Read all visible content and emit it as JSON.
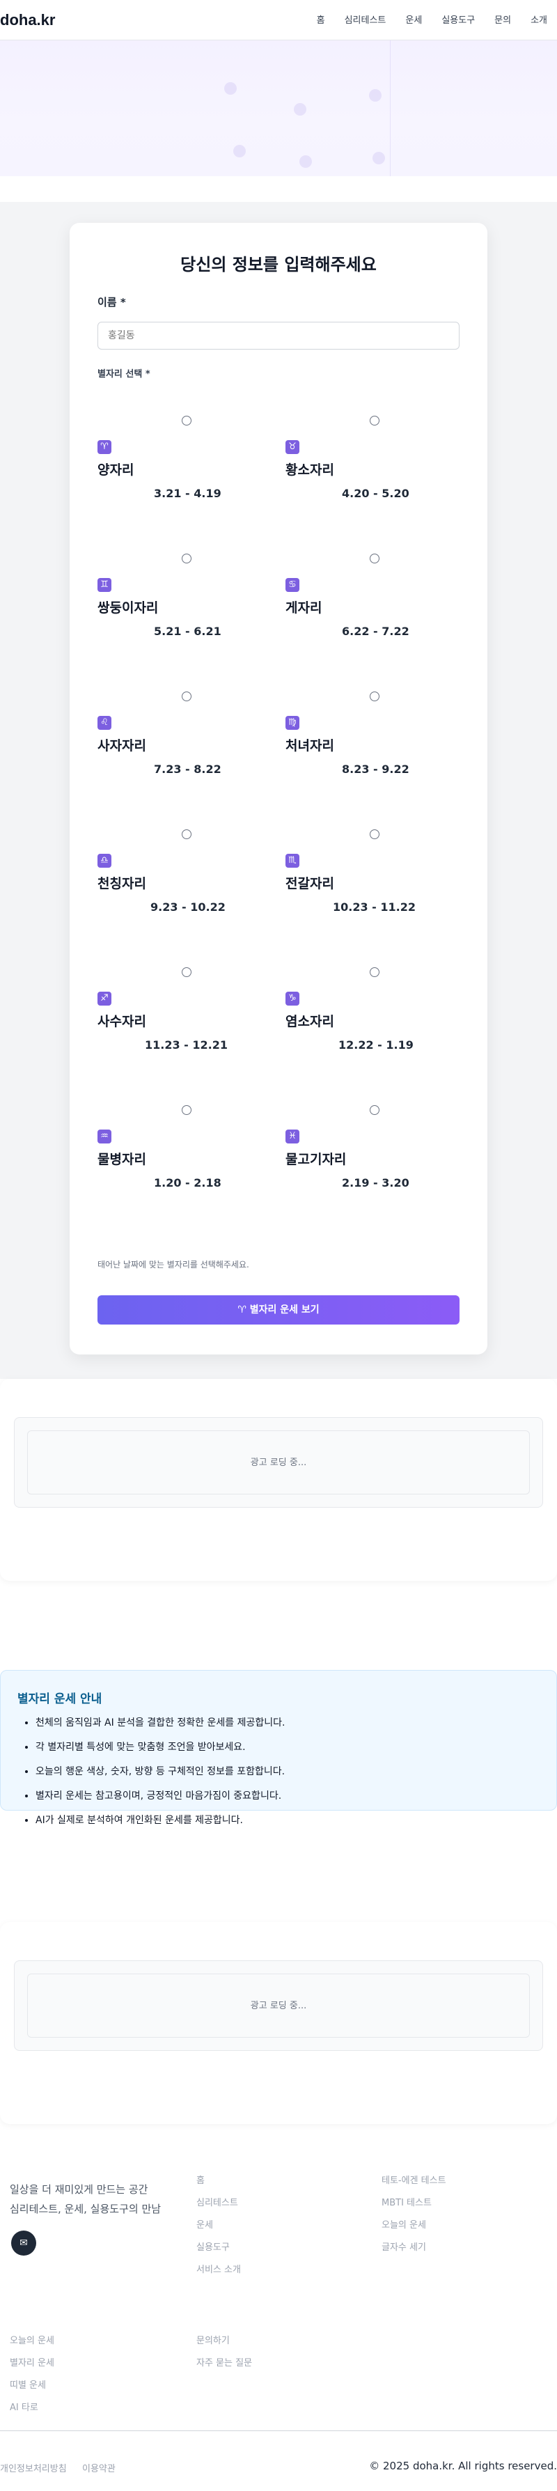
{
  "header": {
    "logo": "doha.kr",
    "nav": [
      "홈",
      "심리테스트",
      "운세",
      "실용도구",
      "문의",
      "소개"
    ]
  },
  "form": {
    "title": "당신의 정보를 입력해주세요",
    "name_label": "이름 *",
    "name_placeholder": "홍길동",
    "zodiac_label": "별자리 선택 *",
    "zodiacs": [
      {
        "symbol": "♈",
        "name": "양자리",
        "dates": "3.21 - 4.19"
      },
      {
        "symbol": "♉",
        "name": "황소자리",
        "dates": "4.20 - 5.20"
      },
      {
        "symbol": "♊",
        "name": "쌍둥이자리",
        "dates": "5.21 - 6.21"
      },
      {
        "symbol": "♋",
        "name": "게자리",
        "dates": "6.22 - 7.22"
      },
      {
        "symbol": "♌",
        "name": "사자자리",
        "dates": "7.23 - 8.22"
      },
      {
        "symbol": "♍",
        "name": "처녀자리",
        "dates": "8.23 - 9.22"
      },
      {
        "symbol": "♎",
        "name": "천칭자리",
        "dates": "9.23 - 10.22"
      },
      {
        "symbol": "♏",
        "name": "전갈자리",
        "dates": "10.23 - 11.22"
      },
      {
        "symbol": "♐",
        "name": "사수자리",
        "dates": "11.23 - 12.21"
      },
      {
        "symbol": "♑",
        "name": "염소자리",
        "dates": "12.22 - 1.19"
      },
      {
        "symbol": "♒",
        "name": "물병자리",
        "dates": "1.20 - 2.18"
      },
      {
        "symbol": "♓",
        "name": "물고기자리",
        "dates": "2.19 - 3.20"
      }
    ],
    "hint": "태어난 날짜에 맞는 별자리를 선택해주세요.",
    "submit_label": "♈ 별자리 운세 보기"
  },
  "ads": {
    "loading_text": "광고 로딩 중..."
  },
  "info": {
    "title": "별자리 운세 안내",
    "items": [
      "천체의 움직임과 AI 분석을 결합한 정확한 운세를 제공합니다.",
      "각 별자리별 특성에 맞는 맞춤형 조언을 받아보세요.",
      "오늘의 행운 색상, 숫자, 방향 등 구체적인 정보를 포함합니다.",
      "별자리 운세는 참고용이며, 긍정적인 마음가짐이 중요합니다.",
      "AI가 실제로 분석하여 개인화된 운세를 제공합니다."
    ]
  },
  "footer": {
    "description_line1": "일상을 더 재미있게 만드는 공간",
    "description_line2": "심리테스트, 운세, 실용도구의 만남",
    "icon": "✉",
    "col2": [
      "홈",
      "심리테스트",
      "운세",
      "실용도구",
      "서비스 소개"
    ],
    "col3": [
      "테토-에겐 테스트",
      "MBTI 테스트",
      "오늘의 운세",
      "글자수 세기"
    ],
    "col1_bottom": [
      "오늘의 운세",
      "별자리 운세",
      "띠별 운세",
      "AI 타로"
    ],
    "col2_bottom": [
      "문의하기",
      "자주 묻는 질문"
    ],
    "legal": [
      "개인정보처리방침",
      "이용약관"
    ],
    "copyright": "© 2025 doha.kr. All rights reserved."
  },
  "colors": {
    "accent": "#7c5fe0",
    "button_start": "#6c63f0",
    "button_end": "#8b5cf6",
    "info_title": "#0b5f8f"
  }
}
